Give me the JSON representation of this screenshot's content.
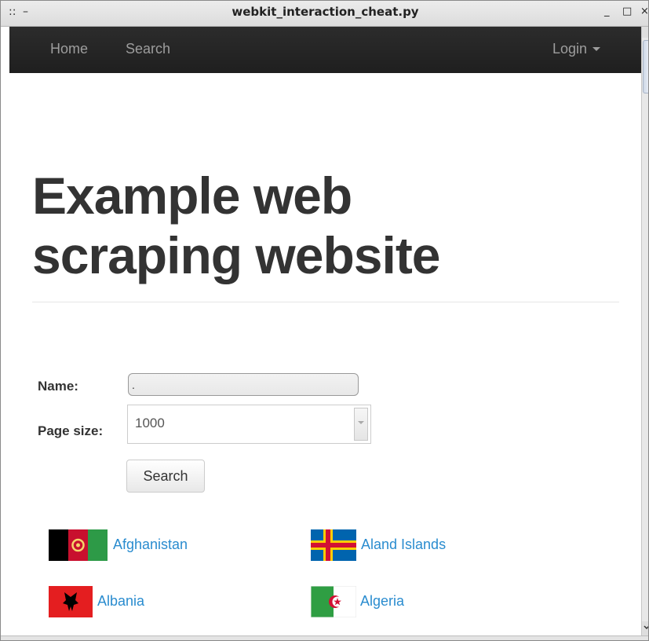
{
  "window": {
    "title": "webkit_interaction_cheat.py",
    "grip_glyph": "::",
    "menu_glyph": "–",
    "minimize_glyph": "_",
    "maximize_glyph": "□",
    "close_glyph": "×"
  },
  "navbar": {
    "home": "Home",
    "search": "Search",
    "login": "Login"
  },
  "hero": {
    "line1": "Example web",
    "line2": "scraping website"
  },
  "form": {
    "name_label": "Name:",
    "name_value": ".",
    "page_size_label": "Page size:",
    "page_size_value": "1000",
    "search_button": "Search"
  },
  "countries": [
    {
      "name": "Afghanistan",
      "flag": "afghanistan-flag"
    },
    {
      "name": "Aland Islands",
      "flag": "aland-islands-flag"
    },
    {
      "name": "Albania",
      "flag": "albania-flag"
    },
    {
      "name": "Algeria",
      "flag": "algeria-flag"
    }
  ],
  "colors": {
    "navbar_bg": "#222222",
    "nav_text": "#9d9d9d",
    "link": "#2a8ccf",
    "heading": "#333333"
  }
}
